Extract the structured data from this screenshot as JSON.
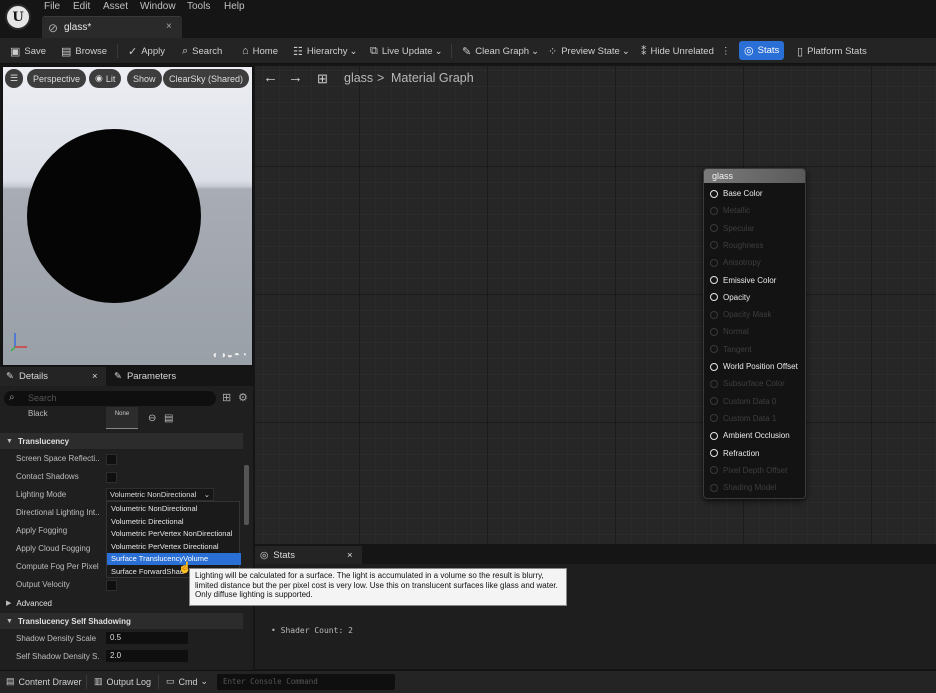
{
  "app": {
    "logo_letter": "U"
  },
  "menu": [
    "File",
    "Edit",
    "Asset",
    "Window",
    "Tools",
    "Help"
  ],
  "tab": {
    "label": "glass*",
    "close": "×"
  },
  "toolbar": {
    "save": "Save",
    "browse": "Browse",
    "apply": "Apply",
    "search": "Search",
    "home": "Home",
    "hierarchy": "Hierarchy",
    "live_update": "Live Update",
    "clean_graph": "Clean Graph",
    "preview_state": "Preview State",
    "hide_unrelated": "Hide Unrelated",
    "stats": "Stats",
    "platform_stats": "Platform Stats"
  },
  "viewport": {
    "perspective": "Perspective",
    "lit": "Lit",
    "show": "Show",
    "sky": "ClearSky (Shared)"
  },
  "details": {
    "tab_details": "Details",
    "tab_parameters": "Parameters",
    "search_placeholder": "Search",
    "black_label": "Black",
    "none_label": "None",
    "translucency_header": "Translucency",
    "rows": {
      "ssr": "Screen Space Reflecti...",
      "contact_shadows": "Contact Shadows",
      "lighting_mode": "Lighting Mode",
      "directional_lighting": "Directional Lighting Int...",
      "apply_fogging": "Apply Fogging",
      "apply_cloud_fogging": "Apply Cloud Fogging",
      "compute_fog": "Compute Fog Per Pixel",
      "output_velocity": "Output Velocity"
    },
    "lighting_mode_value": "Volumetric NonDirectional",
    "lighting_mode_options": [
      "Volumetric NonDirectional",
      "Volumetric Directional",
      "Volumetric PerVertex NonDirectional",
      "Volumetric PerVertex Directional",
      "Surface TranslucencyVolume",
      "Surface ForwardShad"
    ],
    "advanced_header": "Advanced",
    "self_shadow_header": "Translucency Self Shadowing",
    "shadow_density_label": "Shadow Density Scale",
    "shadow_density_value": "0.5",
    "self_shadow_density_label": "Self Shadow Density S...",
    "self_shadow_density_value": "2.0"
  },
  "graph": {
    "breadcrumb_root": "glass",
    "breadcrumb_sep": ">",
    "breadcrumb_page": "Material Graph",
    "node_title": "glass",
    "pins": [
      {
        "label": "Base Color",
        "enabled": true
      },
      {
        "label": "Metallic",
        "enabled": false
      },
      {
        "label": "Specular",
        "enabled": false
      },
      {
        "label": "Roughness",
        "enabled": false
      },
      {
        "label": "Anisotropy",
        "enabled": false
      },
      {
        "label": "Emissive Color",
        "enabled": true
      },
      {
        "label": "Opacity",
        "enabled": true
      },
      {
        "label": "Opacity Mask",
        "enabled": false
      },
      {
        "label": "Normal",
        "enabled": false
      },
      {
        "label": "Tangent",
        "enabled": false
      },
      {
        "label": "World Position Offset",
        "enabled": true
      },
      {
        "label": "Subsurface Color",
        "enabled": false
      },
      {
        "label": "Custom Data 0",
        "enabled": false
      },
      {
        "label": "Custom Data 1",
        "enabled": false
      },
      {
        "label": "Ambient Occlusion",
        "enabled": true
      },
      {
        "label": "Refraction",
        "enabled": true
      },
      {
        "label": "Pixel Depth Offset",
        "enabled": false
      },
      {
        "label": "Shading Model",
        "enabled": false
      }
    ]
  },
  "stats": {
    "tab": "Stats",
    "shader_count": "Shader Count: 2",
    "tooltip": "Lighting will be calculated for a surface. The light is accumulated in a volume so the result is blurry, limited distance but the per pixel cost is very low. Use this on translucent surfaces like glass and water. Only diffuse lighting is supported."
  },
  "statusbar": {
    "content_drawer": "Content Drawer",
    "output_log": "Output Log",
    "cmd": "Cmd",
    "console_placeholder": "Enter Console Command"
  }
}
